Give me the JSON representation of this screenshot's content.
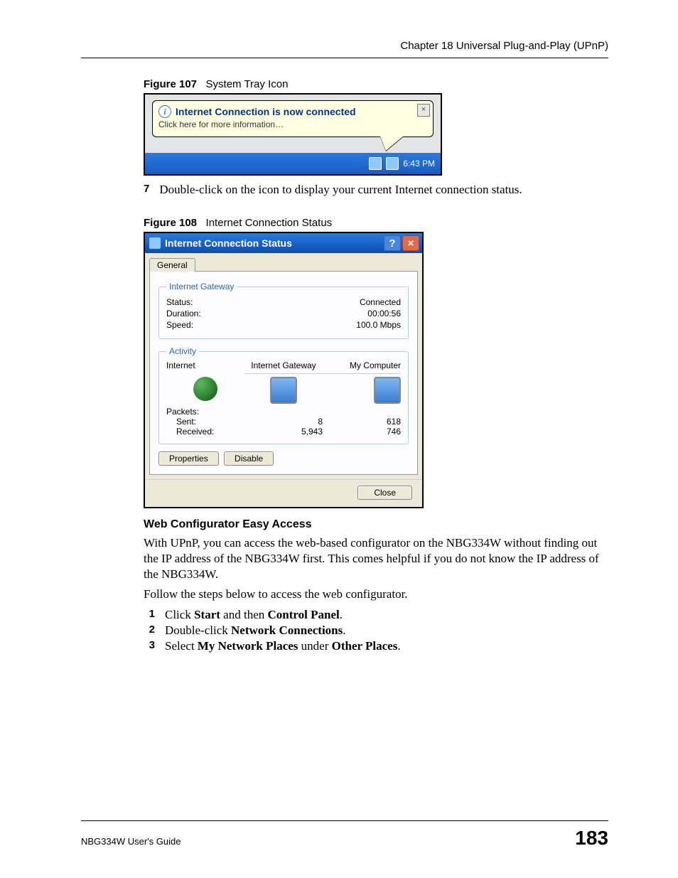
{
  "header": {
    "chapter": "Chapter 18 Universal Plug-and-Play (UPnP)"
  },
  "fig107": {
    "caption_num": "Figure 107",
    "caption_title": "System Tray Icon",
    "balloon_title": "Internet Connection is now connected",
    "balloon_sub": "Click here for more information…",
    "balloon_close": "×",
    "clock": "6:43 PM"
  },
  "step7": {
    "num": "7",
    "text": "Double-click on the icon to display your current Internet connection status."
  },
  "fig108": {
    "caption_num": "Figure 108",
    "caption_title": "Internet Connection Status",
    "title": "Internet Connection Status",
    "tab": "General",
    "group1_legend": "Internet Gateway",
    "status_label": "Status:",
    "status_value": "Connected",
    "duration_label": "Duration:",
    "duration_value": "00:00:56",
    "speed_label": "Speed:",
    "speed_value": "100.0 Mbps",
    "group2_legend": "Activity",
    "col1": "Internet",
    "col2": "Internet Gateway",
    "col3": "My Computer",
    "packets_label": "Packets:",
    "sent_label": "Sent:",
    "sent_gw": "8",
    "sent_pc": "618",
    "recv_label": "Received:",
    "recv_gw": "5,943",
    "recv_pc": "746",
    "btn_properties": "Properties",
    "btn_disable": "Disable",
    "btn_close": "Close",
    "help_glyph": "?",
    "close_glyph": "×"
  },
  "subhead": "Web Configurator Easy Access",
  "para1": "With UPnP, you can access the web-based configurator on the NBG334W without finding out the IP address of the NBG334W first. This comes helpful if you do not know the IP address of the NBG334W.",
  "para2": "Follow the steps below to access the web configurator.",
  "steps": {
    "s1n": "1",
    "s1a": "Click ",
    "s1b": "Start",
    "s1c": " and then ",
    "s1d": "Control Panel",
    "s1e": ".",
    "s2n": "2",
    "s2a": "Double-click ",
    "s2b": "Network Connections",
    "s2c": ".",
    "s3n": "3",
    "s3a": "Select ",
    "s3b": "My Network Places",
    "s3c": " under ",
    "s3d": "Other Places",
    "s3e": "."
  },
  "footer": {
    "guide": "NBG334W User's Guide",
    "page": "183"
  }
}
